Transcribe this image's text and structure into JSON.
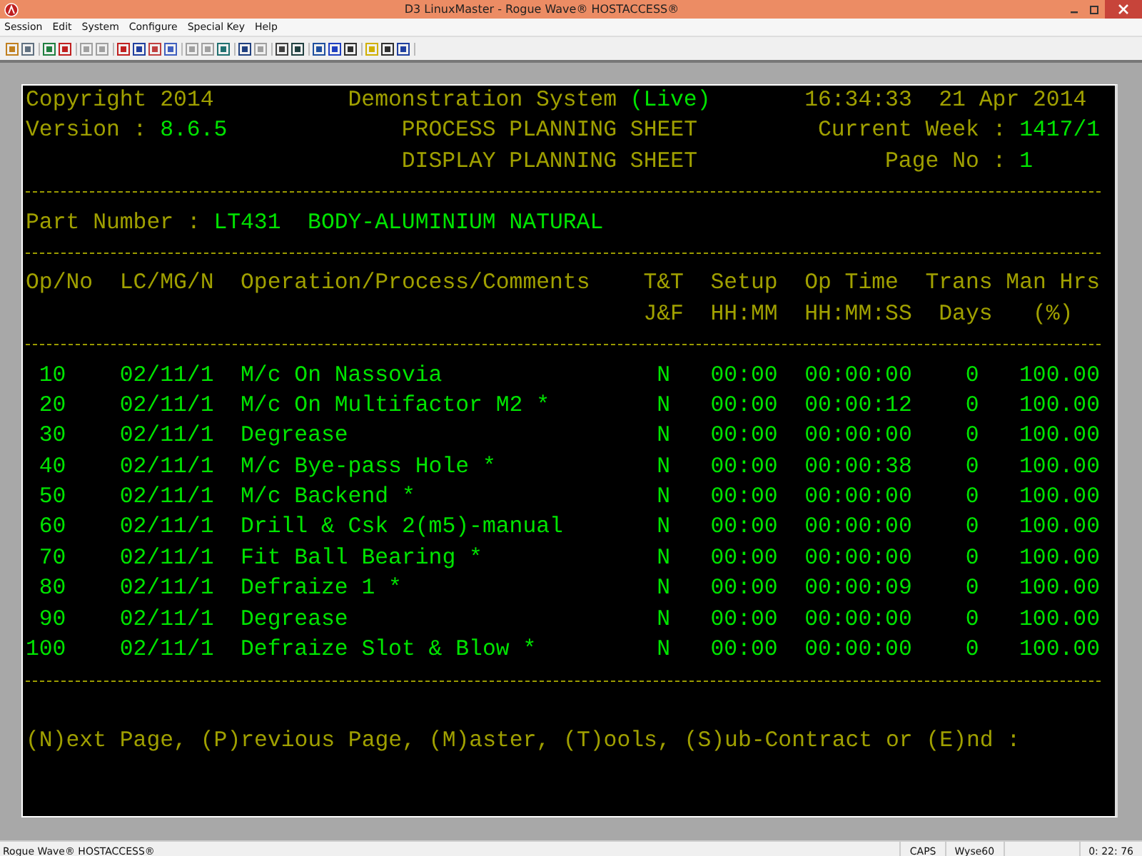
{
  "window": {
    "title": "D3 LinuxMaster - Rogue Wave® HOSTACCESS®"
  },
  "menu": [
    "Session",
    "Edit",
    "System",
    "Configure",
    "Special Key",
    "Help"
  ],
  "terminal": {
    "header": {
      "copyright": "Copyright 2014",
      "system": "Demonstration System",
      "mode": "(Live)",
      "time": "16:34:33",
      "date": "21 Apr 2014",
      "version_label": "Version :",
      "version": "8.6.5",
      "title_1": "PROCESS PLANNING SHEET",
      "week_label": "Current Week :",
      "week": "1417/1",
      "title_2": "DISPLAY PLANNING SHEET",
      "page_label": "Page No :",
      "page": "1"
    },
    "part": {
      "label": "Part Number :",
      "number": "LT431",
      "description": "BODY-ALUMINIUM NATURAL"
    },
    "columns": [
      {
        "line_1": "Op/No"
      },
      {
        "line_1": "LC/MG/N"
      },
      {
        "line_1": "Operation/Process/Comments"
      },
      {
        "line_1": "T&T",
        "line_2": "J&F"
      },
      {
        "line_1": "Setup",
        "line_2": "HH:MM"
      },
      {
        "line_1": "Op Time",
        "line_2": "HH:MM:SS"
      },
      {
        "line_1": "Trans",
        "line_2": "Days"
      },
      {
        "line_1": "Man Hrs",
        "line_2": "(%)"
      }
    ],
    "rows": [
      {
        "op": "10",
        "lc": "02/11/1",
        "operation": "M/c On Nassovia",
        "tt": "N",
        "setup": "00:00",
        "op_time": "00:00:00",
        "trans": "0",
        "man_hrs": "100.00"
      },
      {
        "op": "20",
        "lc": "02/11/1",
        "operation": "M/c On Multifactor M2 *",
        "tt": "N",
        "setup": "00:00",
        "op_time": "00:00:12",
        "trans": "0",
        "man_hrs": "100.00"
      },
      {
        "op": "30",
        "lc": "02/11/1",
        "operation": "Degrease",
        "tt": "N",
        "setup": "00:00",
        "op_time": "00:00:00",
        "trans": "0",
        "man_hrs": "100.00"
      },
      {
        "op": "40",
        "lc": "02/11/1",
        "operation": "M/c Bye-pass Hole *",
        "tt": "N",
        "setup": "00:00",
        "op_time": "00:00:38",
        "trans": "0",
        "man_hrs": "100.00"
      },
      {
        "op": "50",
        "lc": "02/11/1",
        "operation": "M/c Backend *",
        "tt": "N",
        "setup": "00:00",
        "op_time": "00:00:00",
        "trans": "0",
        "man_hrs": "100.00"
      },
      {
        "op": "60",
        "lc": "02/11/1",
        "operation": "Drill & Csk 2(m5)-manual",
        "tt": "N",
        "setup": "00:00",
        "op_time": "00:00:00",
        "trans": "0",
        "man_hrs": "100.00"
      },
      {
        "op": "70",
        "lc": "02/11/1",
        "operation": "Fit Ball Bearing *",
        "tt": "N",
        "setup": "00:00",
        "op_time": "00:00:00",
        "trans": "0",
        "man_hrs": "100.00"
      },
      {
        "op": "80",
        "lc": "02/11/1",
        "operation": "Defraize 1 *",
        "tt": "N",
        "setup": "00:00",
        "op_time": "00:00:09",
        "trans": "0",
        "man_hrs": "100.00"
      },
      {
        "op": "90",
        "lc": "02/11/1",
        "operation": "Degrease",
        "tt": "N",
        "setup": "00:00",
        "op_time": "00:00:00",
        "trans": "0",
        "man_hrs": "100.00"
      },
      {
        "op": "100",
        "lc": "02/11/1",
        "operation": "Defraize Slot & Blow *",
        "tt": "N",
        "setup": "00:00",
        "op_time": "00:00:00",
        "trans": "0",
        "man_hrs": "100.00"
      }
    ],
    "prompt": "(N)ext Page, (P)revious Page, (M)aster, (T)ools, (S)ub-Contract or (E)nd :"
  },
  "status_bar": {
    "app": "Rogue Wave® HOSTACCESS®",
    "caps": "CAPS",
    "emulation": "Wyse60",
    "position": "0: 22: 76"
  }
}
